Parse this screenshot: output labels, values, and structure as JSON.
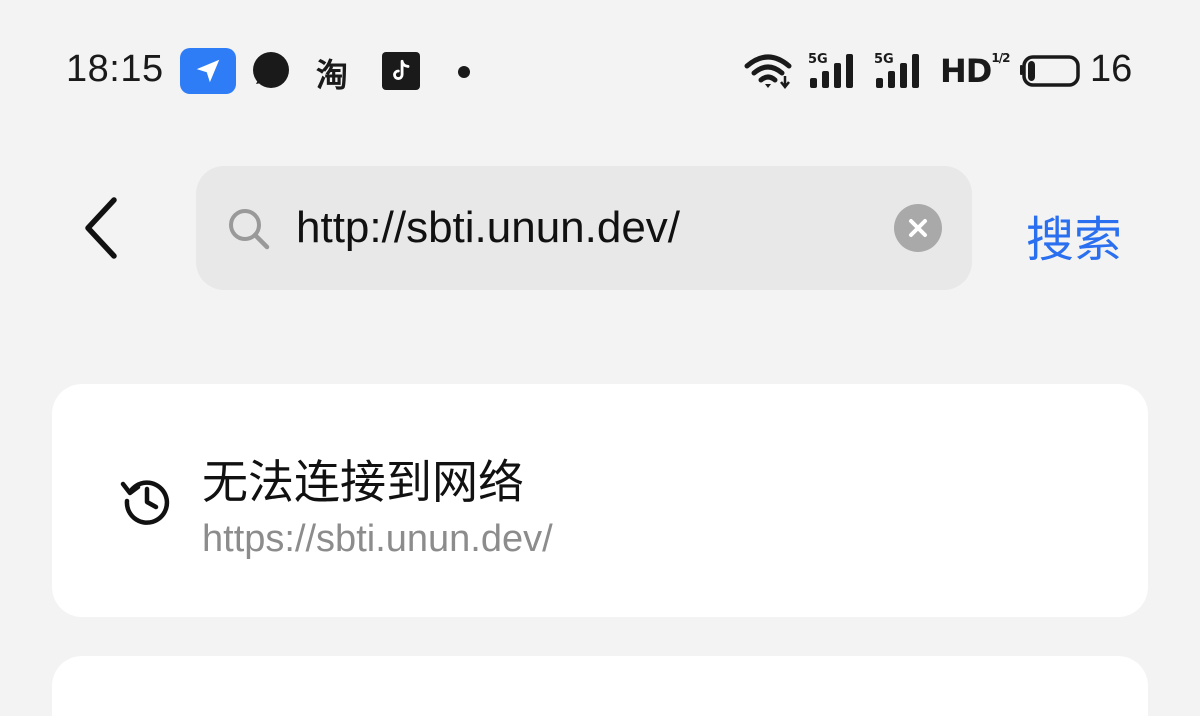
{
  "status_bar": {
    "time": "18:15",
    "icons": [
      "location-arrow-icon",
      "chat-bubble-icon",
      "taobao-icon",
      "tiktok-icon",
      "notification-dot-icon",
      "wifi-icon",
      "signal-5g-icon",
      "signal-5g-icon",
      "hd-icon",
      "battery-icon"
    ],
    "taobao_glyph": "淘",
    "network_label": "5G",
    "hd_label": "HD",
    "hd_superscript": "1/2",
    "battery_level": "16",
    "location_badge_color": "#2e7cf6"
  },
  "search_bar": {
    "query": "http://sbti.unun.dev/",
    "search_button_label": "搜索",
    "accent_color": "#2a6ff0"
  },
  "suggestion": {
    "title": "无法连接到网络",
    "url": "https://sbti.unun.dev/"
  }
}
